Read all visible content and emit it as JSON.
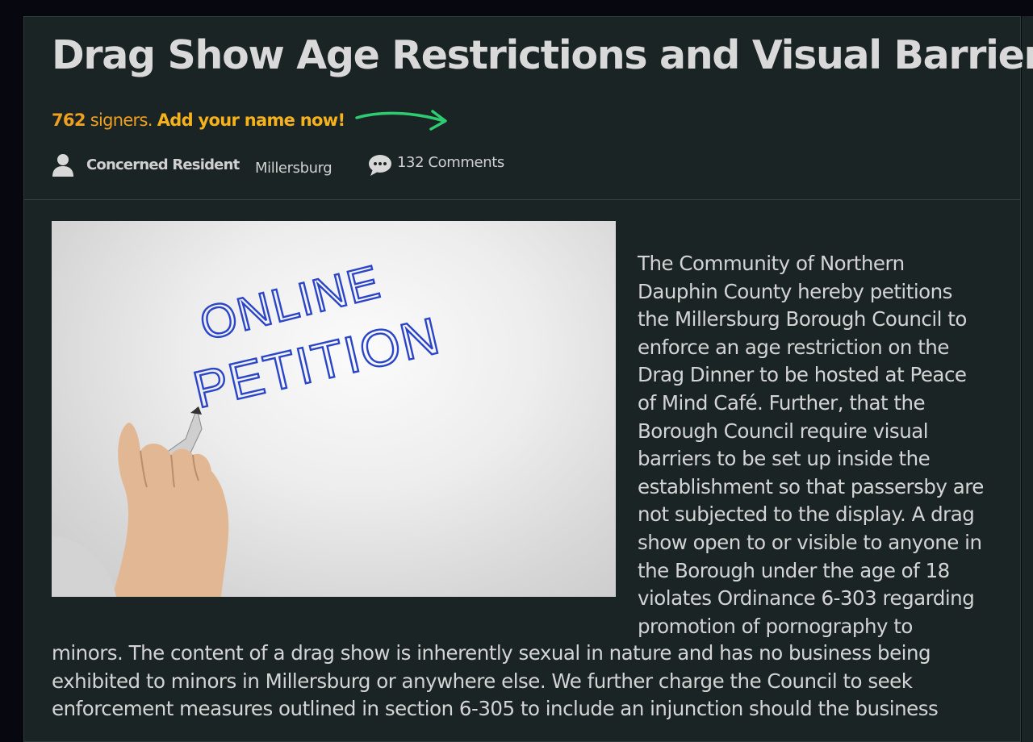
{
  "petition": {
    "title": "Drag Show Age Restrictions and Visual Barriers",
    "signer_count": "762",
    "signers_suffix": " signers. ",
    "call_to_action": "Add your name now!",
    "author": "Concerned Resident",
    "location": "Millersburg",
    "comments": "132 Comments"
  },
  "image": {
    "line1": "ONLINE",
    "line2": "PETITION"
  },
  "body": {
    "side_lines": [
      "The Community of Northern",
      "Dauphin County hereby petitions",
      "the Millersburg Borough Council to",
      "enforce an age restriction on the",
      "Drag Dinner to be hosted at Peace",
      "of Mind Café. Further, that the",
      "Borough Council require visual",
      "barriers to be set up inside the",
      "establishment so that passersby are",
      "not subjected to the display. A drag",
      "show open to or visible to anyone in",
      "the Borough under the age of 18",
      "violates Ordinance 6-303 regarding",
      "promotion of pornography to"
    ],
    "full_lines": [
      "minors. The content of a drag show is inherently sexual in nature and has no business being",
      "exhibited to minors in Millersburg or anywhere else. We further charge the Council to seek",
      "enforcement measures outlined in section 6-305 to include an injunction should the business"
    ]
  },
  "colors": {
    "background": "#07080f",
    "panel": "#1b2424",
    "accent": "#f0a020",
    "arrow": "#2ecc71",
    "text": "#d4d4d4"
  }
}
